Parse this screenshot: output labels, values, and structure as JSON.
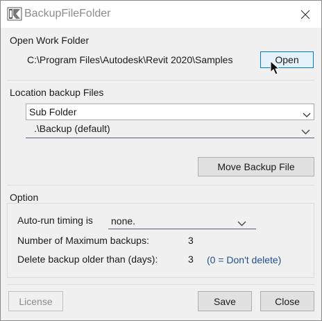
{
  "window": {
    "title": "BackupFileFolder"
  },
  "work_folder": {
    "heading": "Open Work Folder",
    "path": "C:\\Program Files\\Autodesk\\Revit 2020\\Samples",
    "open_label": "Open"
  },
  "location": {
    "heading": "Location backup Files",
    "mode_value": "Sub Folder",
    "folder_value": ".\\Backup (default)"
  },
  "move_label": "Move Backup File",
  "option": {
    "heading": "Option",
    "auto_run_label": "Auto-run timing  is",
    "auto_run_value": "none.",
    "max_backups_label": "Number of Maximum backups:",
    "max_backups_value": "3",
    "delete_days_label": "Delete backup older than (days):",
    "delete_days_value": "3",
    "delete_hint": "(0 = Don't delete)"
  },
  "footer": {
    "license_label": "License",
    "save_label": "Save",
    "close_label": "Close"
  },
  "colors": {
    "hint": "#1f4e8c",
    "focus_border": "#0078d7",
    "disabled_text": "#8c8c8c"
  }
}
